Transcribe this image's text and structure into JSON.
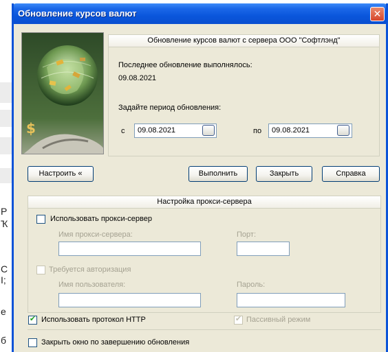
{
  "window": {
    "title": "Обновление курсов валют",
    "close_glyph": "✕"
  },
  "update_group": {
    "header": "Обновление курсов валют с сервера ООО \"Софтлэнд\"",
    "last_update_label": "Последнее обновление выполнялось:",
    "last_update_date": "09.08.2021",
    "period_label": "Задайте период обновления:",
    "from_label": "с",
    "from_date": "09.08.2021",
    "to_label": "по",
    "to_date": "09.08.2021"
  },
  "buttons": {
    "configure": "Настроить «",
    "execute": "Выполнить",
    "close": "Закрыть",
    "help": "Справка"
  },
  "proxy_group": {
    "header": "Настройка прокси-сервера",
    "use_proxy_label": "Использовать прокси-сервер",
    "use_proxy_checked": false,
    "server_name_label": "Имя прокси-сервера:",
    "server_name_value": "",
    "port_label": "Порт:",
    "port_value": "",
    "auth_required_label": "Требуется авторизация",
    "auth_required_checked": false,
    "username_label": "Имя пользователя:",
    "username_value": "",
    "password_label": "Пароль:",
    "password_value": ""
  },
  "options": {
    "use_http_label": "Использовать протокол HTTP",
    "use_http_checked": true,
    "passive_mode_label": "Пассивный режим",
    "passive_mode_checked": true,
    "close_after_update_label": "Закрыть окно по завершению обновления",
    "close_after_update_checked": false
  },
  "background_fragments": [
    "Р",
    "Ҡ",
    "С",
    "Ӏ;",
    "е",
    "б"
  ],
  "colors": {
    "titlebar": "#0a56dc",
    "window_bg": "#ece9d8",
    "check_green": "#21a121"
  }
}
